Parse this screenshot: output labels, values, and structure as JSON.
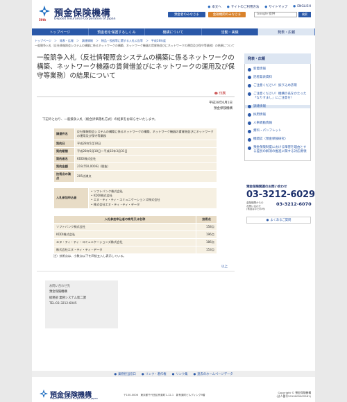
{
  "header": {
    "logo_jp": "預金保険機構",
    "logo_en": "Deposit Insurance Corporation of Japan",
    "logo_since": "50th",
    "toplinks": [
      "本文へ",
      "サイトのご利用方法",
      "サイトマップ",
      "ENGLISH"
    ],
    "btn_depositor": "預金者のみなさま",
    "btn_institution": "金融機関のみなさま",
    "search_placeholder": "Google 提供",
    "search_button": "検索"
  },
  "nav": [
    "トップページ",
    "預金者を保護するしくみ",
    "機構について",
    "活動・実績",
    "発表・広報"
  ],
  "breadcrumb": "トップページ　＞　発表・広報　＞　調達情報　＞　物品・役務等に関する入札公告等　＞　平成28年度",
  "breadcrumb2": "一般競争入札（反社情報照会システムの構築に係るネットワークの構築、ネットワーク機器の賃貸借並びにネットワークの運用及び保守等業務）の結果について",
  "main": {
    "title": "一般競争入札（反社情報照会システムの構築に係るネットワークの構築、ネットワーク機器の賃貸借並びにネットワークの運用及び保守等業務）の結果について",
    "print_label": "印刷",
    "date": "平成28年6月1日",
    "org": "預金保険機構",
    "intro": "下記のとおり、一般競争入札（総合評価落札方式）の結果をお知らせいたします。",
    "details": [
      {
        "label": "調達件名",
        "value": "反社情報照会システムの構築に係るネットワークの構築、ネットワーク機器の賃貸借並びにネットワークの運用及び保守等業務"
      },
      {
        "label": "契約日",
        "value": "平成28年5月18日"
      },
      {
        "label": "契約期間",
        "value": "平成28年5月18日～平成32年3月31日"
      },
      {
        "label": "契約者名",
        "value": "KDDI株式会社"
      },
      {
        "label": "契約金額",
        "value": "219,550,000円（税抜）"
      },
      {
        "label": "技術点の満点",
        "value": "205点満点"
      }
    ],
    "participants_label": "入札参加申込者",
    "participants": [
      "ソフトバンク株式会社",
      "KDDI株式会社",
      "エヌ・ティ・ティ・コミュニケーションズ株式会社",
      "株式会社エヌ・ティ・ティ・データ"
    ],
    "score_head_name": "入札参加申込者の商号又は名称",
    "score_head_pts": "技術点",
    "scores": [
      {
        "name": "ソフトバンク株式会社",
        "pts": "158点"
      },
      {
        "name": "KDDI株式会社",
        "pts": "196点"
      },
      {
        "name": "エヌ・ティ・ティ・コミュニケーションズ株式会社",
        "pts": "186点"
      },
      {
        "name": "株式会社エヌ・ティ・ティ・データ",
        "pts": "153点"
      }
    ],
    "note": "注）技術点は、小数点以下を四捨五入し表示している。",
    "ijo": "以上",
    "contact": [
      "お問い合わせ先",
      "預金保険機構",
      "総務部 業務システム第二課",
      "TEL:03-3212-6045"
    ]
  },
  "sidebar": {
    "heading": "発表・広報",
    "items": [
      "新着情報",
      "記者発表資料",
      "ご注意ください！振り込め詐欺",
      "ご注意ください！機構の名をかたった「なりすまし」にご注意を！",
      "調達情報",
      "採用情報",
      "人事異動情報",
      "資料・パンフレット",
      "機関誌（預金保険研究）",
      "預金保険制度における障害を理由とする差別の解消の推進に関する対応要領"
    ],
    "phone_label": "預金保険関連のお問い合わせ",
    "phone_main": "03-3212-6029",
    "phone_sub1": "金融機関からの",
    "phone_sub2": "お問い合わせ",
    "phone_sub3": "(電話は平日のみ)",
    "phone_alt": "03-3212-6070",
    "faq": "よくあるご質問"
  },
  "footer": {
    "links": [
      "業務担当窓口",
      "リンク・著作権",
      "リンク集",
      "過去のホームページデータ"
    ],
    "logo_jp": "預金保険機構",
    "logo_en": "Deposit Insurance Corporation of Japan",
    "address": "〒100-0006　東京都千代田区有楽町1-12-1　新有楽町ビルディング9階",
    "copyright": "Copyright © 預金保険機構",
    "corp_no": "(法人番号2010005002581)"
  }
}
